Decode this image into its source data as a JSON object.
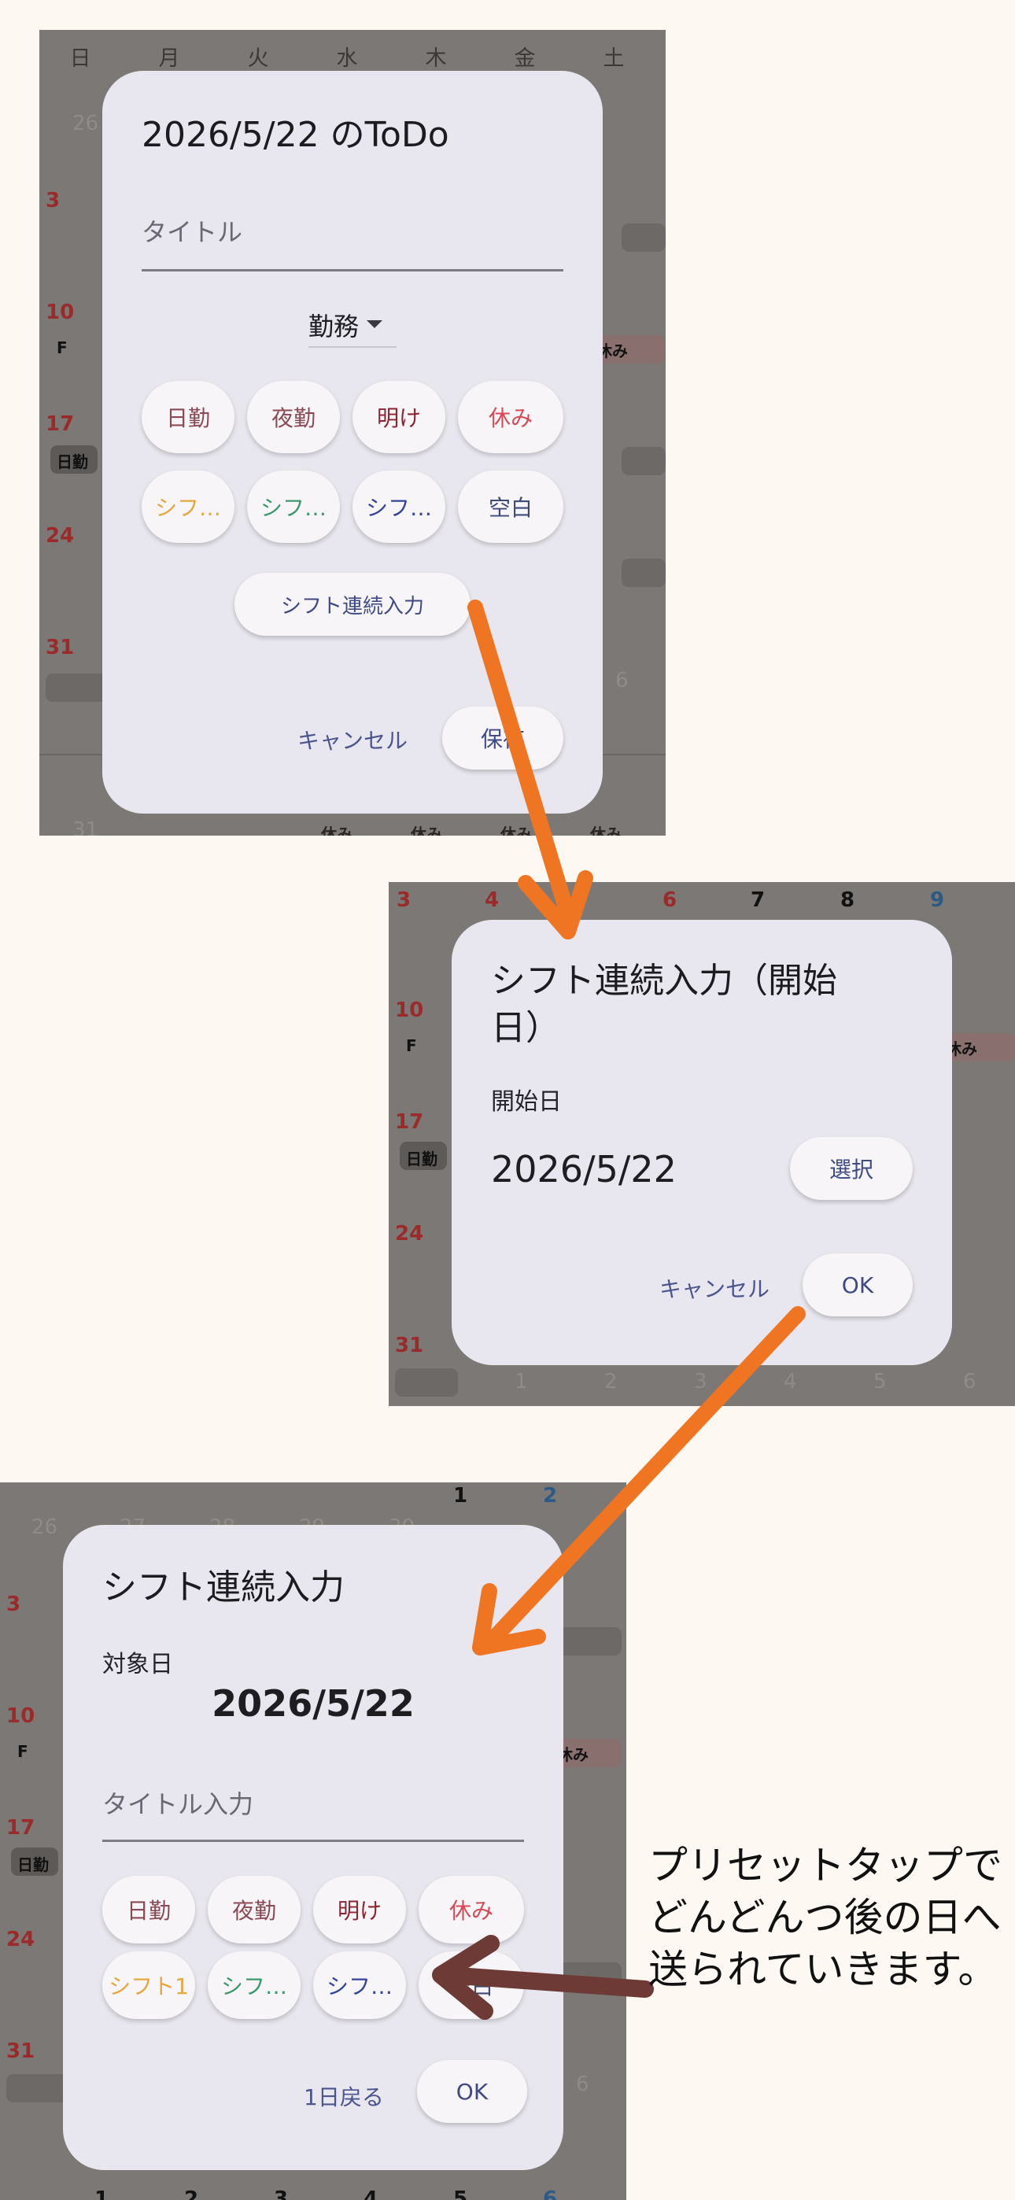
{
  "screenshot1": {
    "weekdays": [
      "日",
      "月",
      "火",
      "水",
      "木",
      "金",
      "土"
    ],
    "bg_numbers": [
      "26",
      "3",
      "10",
      "17",
      "24",
      "31",
      "6",
      "31"
    ],
    "bg_labels": {
      "f": "F",
      "nikkin": "日勤",
      "yasumi": "休み"
    },
    "bg_bottom_labels": [
      "休み",
      "休み",
      "休み",
      "休み"
    ],
    "dialog": {
      "title": "2026/5/22 のToDo",
      "title_placeholder": "タイトル",
      "category": "勤務",
      "presets": [
        "日勤",
        "夜勤",
        "明け",
        "休み",
        "シフ…",
        "シフ…",
        "シフ…",
        "空白"
      ],
      "bulk_button": "シフト連続入力",
      "cancel": "キャンセル",
      "save": "保存"
    }
  },
  "screenshot2": {
    "header_numbers": [
      "3",
      "4",
      "6",
      "7",
      "8",
      "9"
    ],
    "bg_numbers": [
      "10",
      "17",
      "24",
      "31"
    ],
    "bottom_row": [
      "1",
      "2",
      "3",
      "4",
      "5",
      "6"
    ],
    "dialog": {
      "title_line1": "シフト連続入力（開始",
      "title_line2": "日）",
      "start_label": "開始日",
      "start_date": "2026/5/22",
      "select_button": "選択",
      "cancel": "キャンセル",
      "ok": "OK"
    }
  },
  "screenshot3": {
    "top_numbers": [
      "1",
      "2"
    ],
    "faded_numbers": [
      "26",
      "27",
      "28",
      "29",
      "30"
    ],
    "bg_numbers": [
      "3",
      "10",
      "17",
      "24",
      "31",
      "6"
    ],
    "bottom_row": [
      "1",
      "2",
      "3",
      "4",
      "5",
      "6"
    ],
    "dialog": {
      "title": "シフト連続入力",
      "target_label": "対象日",
      "target_date": "2026/5/22",
      "title_input_placeholder": "タイトル入力",
      "presets": [
        "日勤",
        "夜勤",
        "明け",
        "休み",
        "シフト1",
        "シフ…",
        "シフ…",
        "空白"
      ],
      "back_button": "1日戻る",
      "ok": "OK"
    }
  },
  "annotation": {
    "lines": [
      "プリセットタップで",
      "どんどんつ後の日へ",
      "送られていきます。"
    ]
  },
  "colors": {
    "page_bg": "#fdf8f1",
    "dialog_bg": "#e8e6ee",
    "arrow_orange": "#f07522",
    "arrow_brown": "#6e3a36",
    "accent_button_text": "#3e4a86"
  }
}
